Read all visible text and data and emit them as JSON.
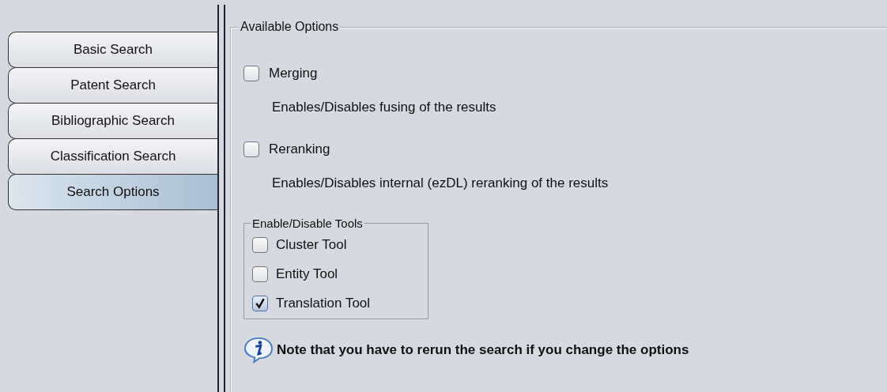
{
  "tabs": [
    {
      "label": "Basic Search",
      "selected": false
    },
    {
      "label": "Patent Search",
      "selected": false
    },
    {
      "label": "Bibliographic Search",
      "selected": false
    },
    {
      "label": "Classification Search",
      "selected": false
    },
    {
      "label": "Search Options",
      "selected": true
    }
  ],
  "available_options": {
    "legend": "Available Options",
    "options": [
      {
        "label": "Merging",
        "checked": false,
        "description": "Enables/Disables fusing of the results"
      },
      {
        "label": "Reranking",
        "checked": false,
        "description": "Enables/Disables internal (ezDL) reranking of the results"
      }
    ],
    "tools": {
      "legend": "Enable/Disable Tools",
      "items": [
        {
          "label": "Cluster Tool",
          "checked": false
        },
        {
          "label": "Entity Tool",
          "checked": false
        },
        {
          "label": "Translation Tool",
          "checked": true
        }
      ]
    },
    "note": "Note that you have to rerun the search if you change the options"
  }
}
